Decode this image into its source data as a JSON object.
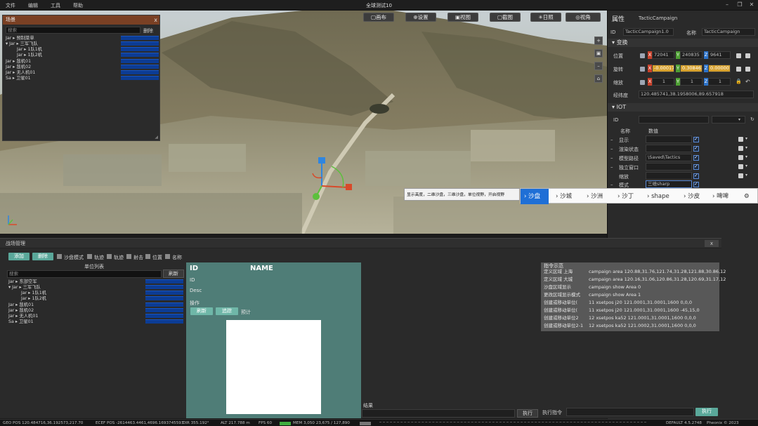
{
  "menu": {
    "file": "文件",
    "edit": "编辑",
    "tools": "工具",
    "help": "帮助"
  },
  "app_title": "全球测试10",
  "window_controls": {
    "minimize": "–",
    "restore": "❐",
    "close": "✕"
  },
  "viewport_toolbar": [
    "▢画布",
    "⊕设置",
    "▣视图",
    "▢截图",
    "✳日照",
    "◎视角"
  ],
  "viewport_side": [
    "+",
    "▣",
    "–",
    "⌂"
  ],
  "float_panel": {
    "title": "场景",
    "close": "x",
    "search_placeholder": "搜索",
    "search_button": "删除",
    "rows": [
      "Jar ▸ 预制菜单",
      "▾ Jar ▸ 三军飞队",
      "Jar ▸ 1队1机",
      "Jar ▸ 1队2机",
      "Jar ▸ 敌机01",
      "Jar ▸ 敌机02",
      "Jar ▸ 无人机01",
      "Sa ▸ 卫星01"
    ]
  },
  "props": {
    "title": "属性",
    "title_value": "TacticCampaign",
    "id_label": "ID",
    "id_value": "TacticCampaign1.0",
    "name_label": "名称",
    "name_value": "TacticCampaign",
    "transform_section": "变换",
    "position_label": "位置",
    "rotation_label": "旋转",
    "scale_label": "缩放",
    "position": {
      "x": "72041",
      "y": "240835",
      "z": "9641"
    },
    "rotation": {
      "x": "-0.0001717",
      "y": "0.308461",
      "z": "0.000001"
    },
    "scale": {
      "x": "1",
      "y": "1",
      "z": "1"
    },
    "latlon_label": "经纬度",
    "latlon_value": "120.485741,38.1958006,89.657918",
    "iot_section": "IOT",
    "iot_id_label": "ID",
    "col_name": "名称",
    "col_data": "数值",
    "iot_rows": [
      {
        "name": "显示",
        "value": ""
      },
      {
        "name": "渲染状态",
        "value": ""
      },
      {
        "name": "模型路径",
        "value": "\\Saved\\Tactics"
      },
      {
        "name": "独立窗口",
        "value": ""
      },
      {
        "name": "缩放",
        "value": ""
      },
      {
        "name": "模式",
        "value": "三维sharp"
      }
    ]
  },
  "tooltip": "显示高度，二维沙盘，三维沙盘，单位视野，开启视野",
  "strip_items": [
    "沙盘",
    "沙城",
    "沙洲",
    "沙丁",
    "shape",
    "沙皮",
    "啤啤",
    "⚙"
  ],
  "dock": {
    "title": "战场管理",
    "close": "x",
    "add_button": "添加",
    "remove_button": "删除",
    "filters": [
      "沙盘模式",
      "轨迹",
      "轨迹",
      "射击",
      "位置",
      "名称"
    ],
    "unit_list_title": "单位列表",
    "search_placeholder": "搜索",
    "search_button": "刷新",
    "rows": [
      "Jar ▸ 东部空军",
      "▾ Jar ▸ 三军飞队",
      "Jar ▸ 1队1机",
      "Jar ▸ 1队2机",
      "Jar ▸ 敌机01",
      "Jar ▸ 敌机02",
      "Jar ▸ 无人机01",
      "Sa ▸ 卫星01"
    ],
    "detail": {
      "id_header": "ID",
      "name_header": "NAME",
      "id_label": "ID",
      "desc_label": "Desc",
      "ops_label": "操作",
      "btn1": "刷新",
      "btn2": "追踪",
      "ops_text": "预计"
    },
    "cmd_title": "指令示范",
    "commands": [
      [
        "定义区域 上海",
        "campaign area 120.88,31.76,121.74,31.28,121.88,30.86,12"
      ],
      [
        "定义区域 大城",
        "campaign area 120.16,31.06,120.86,31.28,120.69,31.17,12"
      ],
      [
        "沙盘区域显示",
        "campaign show Area 0"
      ],
      [
        "更改区域显示模式",
        "campaign show Area 1"
      ],
      [
        "创建或移动单位(",
        "11 xsetpos j20 121.0001,31.0001,1600 0,0,0"
      ],
      [
        "创建或移动单位(",
        "11 xsetpos j20 121.0001,31.0001,1600 -45,15,0"
      ],
      [
        "创建或移动单位2",
        "12 xsetpos ka52 121.0001,31.0001,1600 0,0,0"
      ],
      [
        "创建或移动单位2-1",
        "12 xsetpos ka52 121.0002,31.0001,1600 0,0,0"
      ]
    ],
    "result_label": "结果",
    "exec_button": "执行",
    "exec_cmd_label": "执行指令",
    "exec_button2": "执行"
  },
  "status": {
    "geo_pos": "GEO POS 120.484716,36.192573,217.70",
    "ecef_pos": "ECEF POS -2614463.4461,4696.1693745593",
    "dir": "DIR 355.192°",
    "alt": "ALT 217.788 m",
    "fps": "FPS 60",
    "mem": "MEM 3,050 23,675 / 127,890",
    "default": "DEFAULT 4.5.2748",
    "copyright": "Pheonix © 2023"
  }
}
